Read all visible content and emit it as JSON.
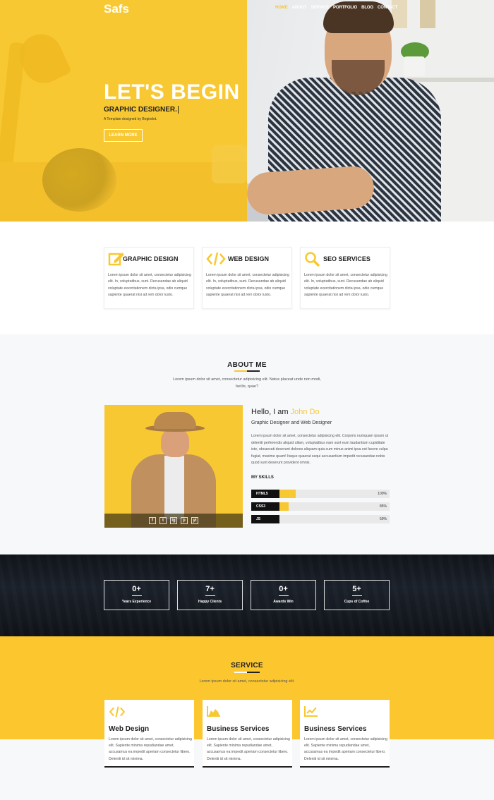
{
  "nav": {
    "logo": "Safs",
    "items": [
      "HOME",
      "ABOUT",
      "SERVICE",
      "PORTFOLIO",
      "BLOG",
      "CONTACT"
    ],
    "active": "HOME"
  },
  "hero": {
    "title": "LET'S BEGIN",
    "subtitle": "GRAPHIC DESIGNER.",
    "small": "A Template designed by Begindot.",
    "button": "LEARN MORE"
  },
  "features": [
    {
      "icon": "edit-icon",
      "title": "GRAPHIC DESIGN",
      "text": "Lorem ipsum dolor sit amet, consectetur adipisicing elit. In, voluptatibus, sunt. Recusandae ab aliquid voluptate exercitationem dicta ipsa, odio cumque sapiente quaerat nisi ad rem dolor iusto."
    },
    {
      "icon": "code-icon",
      "title": "WEB DESIGN",
      "text": "Lorem ipsum dolor sit amet, consectetur adipisicing elit. In, voluptatibus, sunt. Recusandae ab aliquid voluptate exercitationem dicta ipsa, odio cumque sapiente quaerat nisi ad rem dolor iusto."
    },
    {
      "icon": "search-icon",
      "title": "SEO SERVICES",
      "text": "Lorem ipsum dolor sit amet, consectetur adipisicing elit. In, voluptatibus, sunt. Recusandae ab aliquid voluptate exercitationem dicta ipsa, odio cumque sapiente quaerat nisi ad rem dolor iusto."
    }
  ],
  "about": {
    "title": "ABOUT ME",
    "desc": "Lorem ipsum dolor sit amet, consectetur adipisicing elit. Natus placeat unde non modi, facilis, quae?",
    "hello_prefix": "Hello, I am ",
    "name": "John Do",
    "role": "Graphic Designer and Web Designer",
    "text": "Lorem ipsum dolor sit amet, consectetur adipisicing elit. Corporis numquam ipsum ut deleniti perferendis aliquid ullam, voluptatibus nam sunt eum laudantium cupiditate iste, obcaecati deserunt dolores aliquam quia cum minus animi ipsa est facere culpa fugiat, maxime quam! Itaque quaerat sequi accusantium impedit recusandae nobis quod sunt deserunt provident omnis.",
    "skills_title": "MY SKILLS",
    "skills": [
      {
        "name": "HTML5",
        "percent": "100%",
        "value": 0.32
      },
      {
        "name": "CSS3",
        "percent": "85%",
        "value": 0.27
      },
      {
        "name": "JS",
        "percent": "50%",
        "value": 0.2
      }
    ],
    "social": [
      "f",
      "t",
      "ig",
      "p",
      "yt"
    ]
  },
  "stats": [
    {
      "num": "0+",
      "caption": "Years Experience"
    },
    {
      "num": "7+",
      "caption": "Happy Clients"
    },
    {
      "num": "0+",
      "caption": "Awards Win"
    },
    {
      "num": "5+",
      "caption": "Cups of Coffee"
    }
  ],
  "service": {
    "title": "SERVICE",
    "desc": "Lorem ipsum dolor sit amet, consectetur adipisicing elit.",
    "cards": [
      {
        "icon": "code-icon",
        "title": "Web Design",
        "text": "Lorem ipsum dolor sit amet, consectetur adipisicing elit. Sapiente minima repudiandae amet, accusamus ea impedit aperiam consectetur libero. Deleniti id sit minima."
      },
      {
        "icon": "area-chart-icon",
        "title": "Business Services",
        "text": "Lorem ipsum dolor sit amet, consectetur adipisicing elit. Sapiente minima repudiandae amet, accusamus ea impedit aperiam consectetur libero. Deleniti id sit minima."
      },
      {
        "icon": "line-chart-icon",
        "title": "Business Services",
        "text": "Lorem ipsum dolor sit amet, consectetur adipisicing elit. Sapiente minima repudiandae amet, accusamus ea impedit aperiam consectetur libero. Deleniti id sit minima."
      }
    ]
  },
  "colors": {
    "accent": "#f8c832",
    "dark": "#111111"
  }
}
